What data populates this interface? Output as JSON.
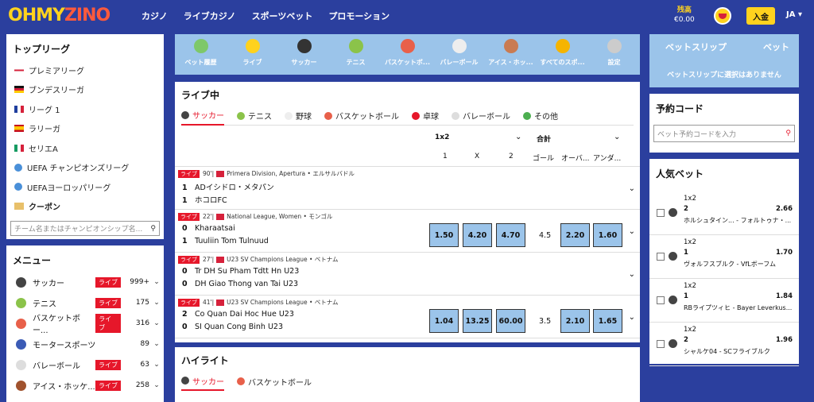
{
  "header": {
    "logo_a": "OHMY",
    "logo_b": "ZINO",
    "nav": [
      "カジノ",
      "ライブカジノ",
      "スポーツベット",
      "プロモーション"
    ],
    "balance_label": "残高",
    "balance": "€0.00",
    "deposit": "入金",
    "lang": "JA"
  },
  "leagues": {
    "title": "トップリーグ",
    "items": [
      {
        "label": "プレミアリーグ",
        "flag": "eng"
      },
      {
        "label": "ブンデスリーガ",
        "flag": "de"
      },
      {
        "label": "リーグ 1",
        "flag": "fr"
      },
      {
        "label": "ラリーガ",
        "flag": "es"
      },
      {
        "label": "セリエA",
        "flag": "it"
      },
      {
        "label": "UEFA チャンピオンズリーグ",
        "flag": "globe"
      },
      {
        "label": "UEFAヨーロッパリーグ",
        "flag": "globe"
      },
      {
        "label": "クーポン",
        "flag": "ticket"
      }
    ],
    "search_placeholder": "チーム名またはチャンピオンシップ名..."
  },
  "menu": {
    "title": "メニュー",
    "items": [
      {
        "label": "サッカー",
        "live": "ライブ",
        "count": "999+",
        "color": "#444"
      },
      {
        "label": "テニス",
        "live": "ライブ",
        "count": "175",
        "color": "#8bc34a"
      },
      {
        "label": "バスケットボー...",
        "live": "ライブ",
        "count": "316",
        "color": "#e8604a"
      },
      {
        "label": "モータースポーツ",
        "live": "",
        "count": "89",
        "color": "#3b5bb5"
      },
      {
        "label": "バレーボール",
        "live": "ライブ",
        "count": "63",
        "color": "#ddd"
      },
      {
        "label": "アイス・ホッケ...",
        "live": "ライブ",
        "count": "258",
        "color": "#a0522d"
      }
    ]
  },
  "sports_tabs": [
    {
      "label": "ベット履歴",
      "color": "#7ec86a"
    },
    {
      "label": "ライブ",
      "color": "#ffd21e"
    },
    {
      "label": "サッカー",
      "color": "#333"
    },
    {
      "label": "テニス",
      "color": "#8bc34a"
    },
    {
      "label": "バスケットボ...",
      "color": "#e8604a"
    },
    {
      "label": "バレーボール",
      "color": "#eee"
    },
    {
      "label": "アイス・ホッ...",
      "color": "#c97b52"
    },
    {
      "label": "すべてのスポ...",
      "color": "#f5b400"
    },
    {
      "label": "設定",
      "color": "#ccc"
    }
  ],
  "live": {
    "title": "ライブ中",
    "tabs": [
      {
        "label": "サッカー",
        "color": "#444"
      },
      {
        "label": "テニス",
        "color": "#8bc34a"
      },
      {
        "label": "野球",
        "color": "#eee"
      },
      {
        "label": "バスケットボール",
        "color": "#e8604a"
      },
      {
        "label": "卓球",
        "color": "#e6172a"
      },
      {
        "label": "バレーボール",
        "color": "#ddd"
      },
      {
        "label": "その他",
        "color": "#4caf50"
      }
    ],
    "market1": "1x2",
    "market2": "合計",
    "cols": [
      "1",
      "X",
      "2",
      "ゴール",
      "オーバ...",
      "アンダ..."
    ],
    "matches": [
      {
        "live": "ライブ",
        "min": "90'",
        "league": "Primera Division, Apertura • エルサルバドル",
        "s1": "1",
        "t1": "ADイシドロ・メタパン",
        "s2": "1",
        "t2": "ホコロFC",
        "odds": []
      },
      {
        "live": "ライブ",
        "min": "22'",
        "league": "National League, Women • モンゴル",
        "s1": "0",
        "t1": "Kharaatsai",
        "s2": "1",
        "t2": "Tuuliin Tom Tulnuud",
        "odds": [
          "1.50",
          "4.20",
          "4.70"
        ],
        "goal": "4.5",
        "ou": [
          "2.20",
          "1.60"
        ]
      },
      {
        "live": "ライブ",
        "min": "27'",
        "league": "U23 SV Champions League • ベトナム",
        "s1": "0",
        "t1": "Tr DH Su Pham Tdtt Hn U23",
        "s2": "0",
        "t2": "DH Giao Thong van Tai U23",
        "odds": []
      },
      {
        "live": "ライブ",
        "min": "41'",
        "league": "U23 SV Champions League • ベトナム",
        "s1": "2",
        "t1": "Co Quan Dai Hoc Hue U23",
        "s2": "0",
        "t2": "SI Quan Cong Binh U23",
        "odds": [
          "1.04",
          "13.25",
          "60.00"
        ],
        "goal": "3.5",
        "ou": [
          "2.10",
          "1.65"
        ]
      }
    ]
  },
  "highlight": {
    "title": "ハイライト",
    "tabs": [
      {
        "label": "サッカー",
        "color": "#444"
      },
      {
        "label": "バスケットボール",
        "color": "#e8604a"
      }
    ]
  },
  "betslip": {
    "tab1": "ベットスリップ",
    "tab2": "ベット",
    "empty": "ベットスリップに選択はありません"
  },
  "booking": {
    "title": "予約コード",
    "placeholder": "ベット予約コードを入力"
  },
  "popular": {
    "title": "人気ベット",
    "items": [
      {
        "market": "1x2",
        "pick": "2",
        "odd": "2.66",
        "teams": "ホルシュタイン...  - フォルトゥナ・..."
      },
      {
        "market": "1x2",
        "pick": "1",
        "odd": "1.70",
        "teams": "ヴォルフスブルク - VfLボーフム"
      },
      {
        "market": "1x2",
        "pick": "1",
        "odd": "1.84",
        "teams": "RBライプツィヒ - Bayer Leverkus..."
      },
      {
        "market": "1x2",
        "pick": "2",
        "odd": "1.96",
        "teams": "シャルケ04  - SCフライブルク"
      }
    ]
  }
}
